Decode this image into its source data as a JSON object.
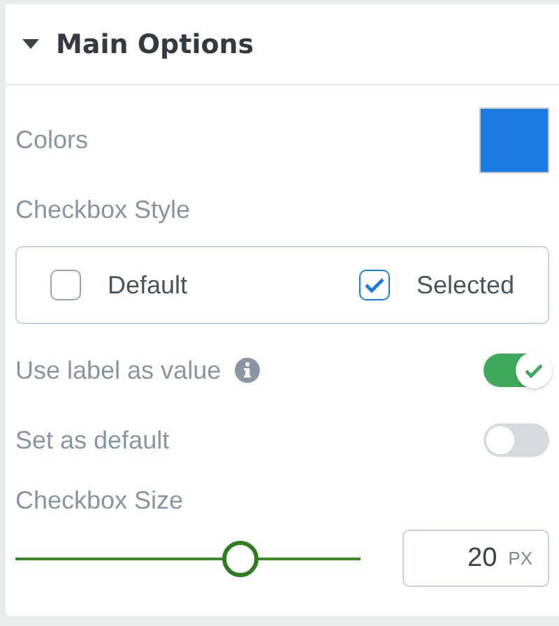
{
  "panel": {
    "title": "Main Options",
    "expanded": true
  },
  "colors": {
    "label": "Colors",
    "color": "#1b7be3"
  },
  "checkbox_style": {
    "label": "Checkbox Style",
    "options": [
      {
        "label": "Default",
        "selected": false
      },
      {
        "label": "Selected",
        "selected": true
      }
    ]
  },
  "toggles": [
    {
      "label": "Use label as value",
      "info": true,
      "on": true
    },
    {
      "label": "Set as default",
      "info": false,
      "on": false
    }
  ],
  "size": {
    "label": "Checkbox Size",
    "level": 0.65,
    "value": "20",
    "unit": "PX"
  }
}
